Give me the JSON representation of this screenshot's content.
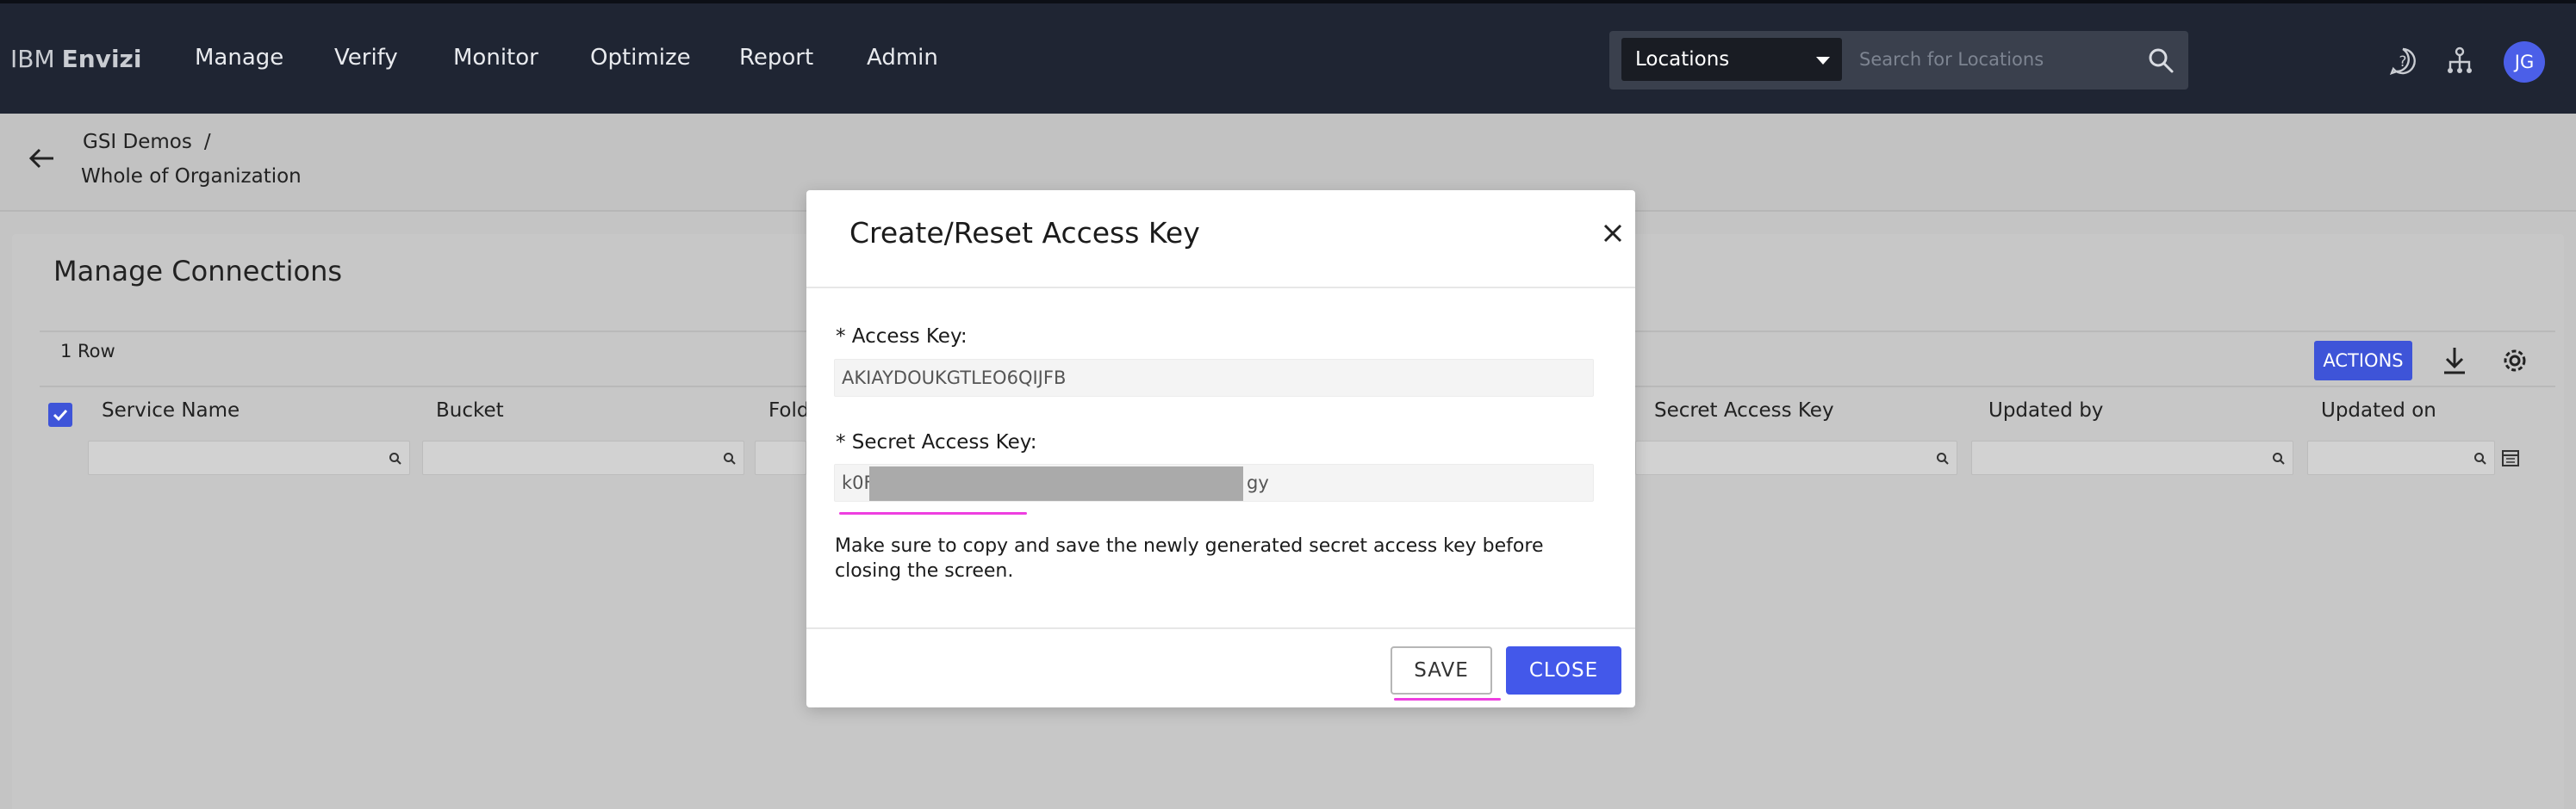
{
  "header": {
    "brand_prefix": "IBM",
    "brand_name": "Envizi",
    "nav": [
      "Manage",
      "Verify",
      "Monitor",
      "Optimize",
      "Report",
      "Admin"
    ],
    "location_select": "Locations",
    "search_placeholder": "Search for Locations",
    "avatar_initials": "JG"
  },
  "breadcrumb": {
    "parent": "GSI Demos",
    "separator": "/",
    "current": "Whole of Organization"
  },
  "panel": {
    "title": "Manage Connections",
    "row_count": "1 Row",
    "actions_label": "ACTIONS",
    "columns": [
      "Service Name",
      "Bucket",
      "Fold",
      "Secret Access Key",
      "Updated by",
      "Updated on"
    ]
  },
  "modal": {
    "title": "Create/Reset Access Key",
    "access_key_label": "* Access Key:",
    "access_key_value": "AKIAYDOUKGTLEO6QIJFB",
    "secret_key_label": "* Secret Access Key:",
    "secret_key_prefix": "k0F",
    "secret_key_suffix": "gy",
    "note": "Make sure to copy and save the newly generated secret access key before closing the screen.",
    "save_label": "SAVE",
    "close_label": "CLOSE"
  },
  "colors": {
    "topbar": "#1f2533",
    "accent": "#4358ea",
    "highlight": "#ee3fe0"
  }
}
